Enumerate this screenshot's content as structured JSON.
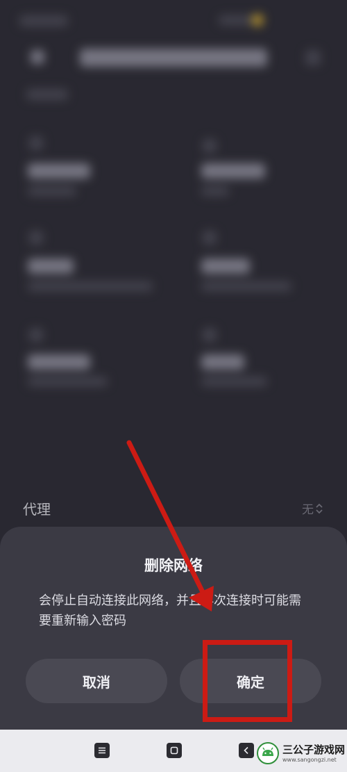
{
  "proxy": {
    "label": "代理",
    "value": "无"
  },
  "dialog": {
    "title": "删除网络",
    "message": "会停止自动连接此网络，并且再次连接时可能需要重新输入密码",
    "cancel_label": "取消",
    "confirm_label": "确定"
  },
  "nav": {
    "menu_icon": "menu-icon",
    "home_icon": "home-icon",
    "back_icon": "back-icon"
  },
  "watermark": {
    "title": "三公子游戏网",
    "url": "www.sangongzi.net"
  },
  "colors": {
    "background": "#2e2d36",
    "dialog": "#3b3a44",
    "button": "#4a4953",
    "annotation_red": "#cc1b14",
    "navbar": "#ebebef"
  }
}
